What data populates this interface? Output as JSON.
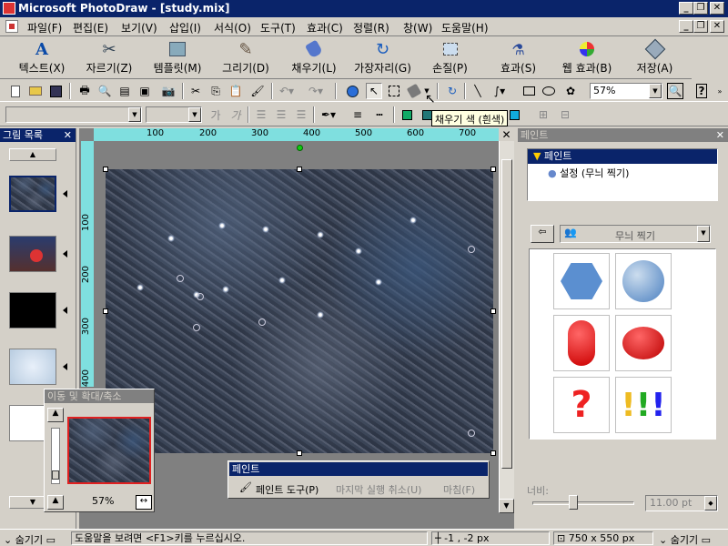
{
  "window": {
    "title": "Microsoft PhotoDraw - [study.mix]"
  },
  "menu": [
    "파일(F)",
    "편집(E)",
    "보기(V)",
    "삽입(I)",
    "서식(O)",
    "도구(T)",
    "효과(C)",
    "정렬(R)",
    "창(W)",
    "도움말(H)"
  ],
  "bigbar": [
    {
      "label": "텍스트(X)",
      "icon": "text-icon"
    },
    {
      "label": "자르기(Z)",
      "icon": "scissors-icon"
    },
    {
      "label": "템플릿(M)",
      "icon": "template-icon"
    },
    {
      "label": "그리기(D)",
      "icon": "pen-icon"
    },
    {
      "label": "채우기(L)",
      "icon": "fill-bucket-icon"
    },
    {
      "label": "가장자리(G)",
      "icon": "edge-icon"
    },
    {
      "label": "손질(P)",
      "icon": "touchup-icon"
    },
    {
      "label": "효과(S)",
      "icon": "effects-icon"
    },
    {
      "label": "웹 효과(B)",
      "icon": "web-effects-icon"
    },
    {
      "label": "저장(A)",
      "icon": "save-wizard-icon"
    }
  ],
  "toolbar": {
    "zoom": "57%"
  },
  "tooltip": "채우기 색 (흰색)",
  "picture_list": {
    "title": "그림 목록"
  },
  "ruler": {
    "h_ticks": [
      "100",
      "200",
      "300",
      "400",
      "500",
      "600",
      "700"
    ],
    "v_ticks": [
      "100",
      "200",
      "300",
      "400"
    ]
  },
  "pan_zoom": {
    "title": "이동 및 확대/축소",
    "zoom": "57%"
  },
  "paint_popup": {
    "title": "페인트",
    "items": [
      "페인트 도구(P)",
      "마지막 실행 취소(U)",
      "마침(F)"
    ]
  },
  "workpane": {
    "title": "페인트",
    "tree_root": "페인트",
    "tree_child": "설정 (무늬 찍기)",
    "gallery_label": "무늬 찍기",
    "width_label": "너비:",
    "width_value": "11.00 pt"
  },
  "status": {
    "hide": "숨기기",
    "help": "도움말을 보려면 <F1>키를 누르십시오.",
    "pos": "-1 , -2  px",
    "size": "750 x 550  px",
    "hide2": "숨기기"
  },
  "colors": {
    "title": "#0a246a",
    "face": "#d4d0c8",
    "ruler": "#7fdfdf"
  }
}
